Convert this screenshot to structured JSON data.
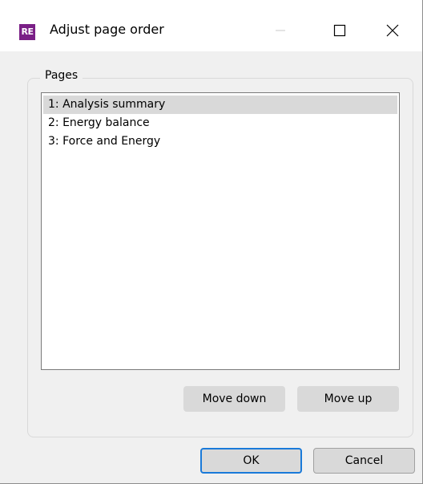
{
  "window": {
    "app_icon_text": "RE",
    "title": "Adjust page order",
    "controls": {
      "minimize_icon": "minimize-icon",
      "maximize_icon": "maximize-icon",
      "close_icon": "close-icon"
    }
  },
  "pages_group": {
    "label": "Pages",
    "items": [
      {
        "label": "1: Analysis summary",
        "selected": true
      },
      {
        "label": "2: Energy balance",
        "selected": false
      },
      {
        "label": "3: Force and Energy",
        "selected": false
      }
    ],
    "move_down_label": "Move down",
    "move_up_label": "Move up"
  },
  "footer": {
    "ok_label": "OK",
    "cancel_label": "Cancel"
  },
  "colors": {
    "selection": "#d9d9d9",
    "accent_focus": "#1a7ad9",
    "app_icon": "#7a1f86"
  }
}
